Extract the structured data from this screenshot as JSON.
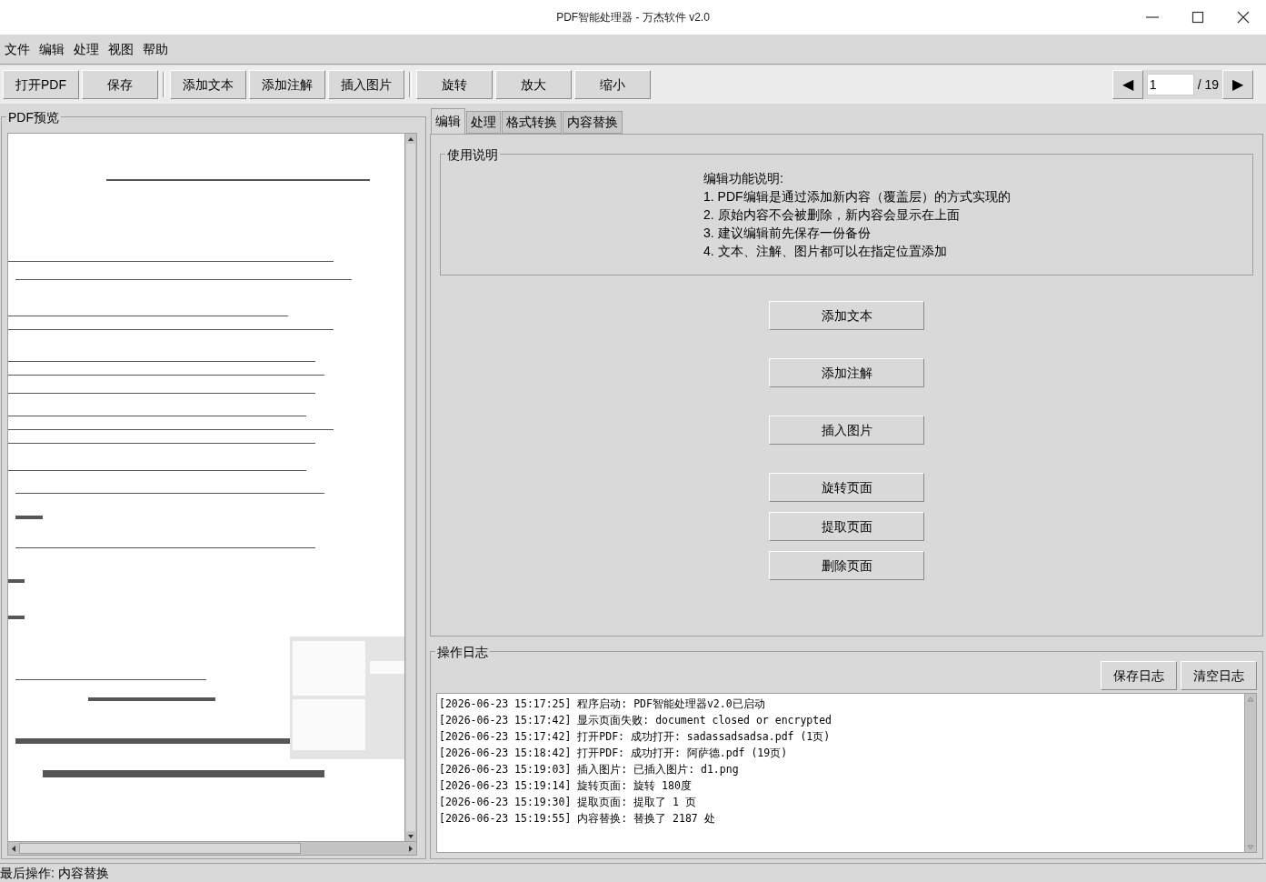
{
  "window": {
    "title": "PDF智能处理器 - 万杰软件 v2.0"
  },
  "menu": [
    "文件",
    "编辑",
    "处理",
    "视图",
    "帮助"
  ],
  "toolbar": {
    "groups": [
      [
        "打开PDF",
        "保存"
      ],
      [
        "添加文本",
        "添加注解",
        "插入图片"
      ],
      [
        "旋转",
        "放大",
        "缩小"
      ]
    ],
    "prev": "◀",
    "page": "1",
    "total": "/ 19",
    "next": "▶"
  },
  "preview": {
    "title": "PDF预览"
  },
  "tabs": [
    {
      "label": "编辑",
      "selected": true
    },
    {
      "label": "处理",
      "selected": false
    },
    {
      "label": "格式转换",
      "selected": false
    },
    {
      "label": "内容替换",
      "selected": false
    }
  ],
  "help": {
    "title": "使用说明",
    "lines": [
      "编辑功能说明:",
      "1. PDF编辑是通过添加新内容（覆盖层）的方式实现的",
      "2. 原始内容不会被删除，新内容会显示在上面",
      "3. 建议编辑前先保存一份备份",
      "4. 文本、注解、图片都可以在指定位置添加"
    ]
  },
  "actions": [
    {
      "label": "添加文本"
    },
    {
      "label": "添加注解"
    },
    {
      "label": "插入图片"
    },
    {
      "label": "旋转页面"
    },
    {
      "label": "提取页面"
    },
    {
      "label": "删除页面"
    }
  ],
  "log": {
    "title": "操作日志",
    "buttons": [
      "保存日志",
      "清空日志"
    ],
    "lines": [
      "[2026-06-23 15:17:25] 程序启动: PDF智能处理器v2.0已启动",
      "[2026-06-23 15:17:42] 显示页面失败: document closed or encrypted",
      "[2026-06-23 15:17:42] 打开PDF: 成功打开: sadassadsadsa.pdf (1页)",
      "[2026-06-23 15:18:42] 打开PDF: 成功打开: 阿萨德.pdf (19页)",
      "[2026-06-23 15:19:03] 插入图片: 已插入图片: d1.png",
      "[2026-06-23 15:19:14] 旋转页面: 旋转 180度",
      "[2026-06-23 15:19:30] 提取页面: 提取了 1 页",
      "[2026-06-23 15:19:55] 内容替换: 替换了 2187 处"
    ]
  },
  "status_bar": "最后操作: 内容替换"
}
